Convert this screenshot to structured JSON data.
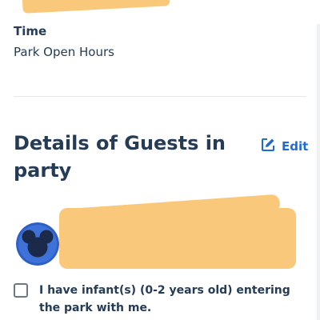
{
  "time_section": {
    "label": "Time",
    "value": "Park Open Hours"
  },
  "guests_section": {
    "title": "Details of Guests in party",
    "edit_label": "Edit",
    "guest_avatar_icon": "mickey-ears-icon",
    "infant_checkbox": {
      "checked": false,
      "label": "I have infant(s) (0-2 years old) entering the park with me."
    }
  },
  "colors": {
    "text": "#253b56",
    "accent": "#1e6bd6",
    "avatar": "#2e5fc7",
    "redaction": "#f9c87a"
  }
}
